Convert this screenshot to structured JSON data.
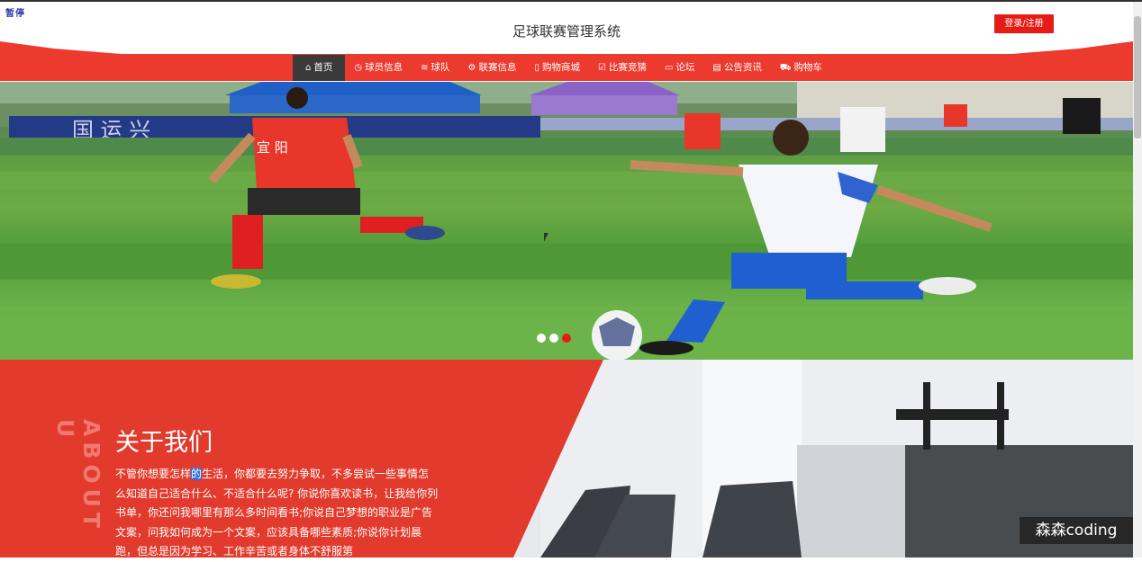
{
  "overlay": {
    "paused_label": "暂停"
  },
  "header": {
    "site_title": "足球联赛管理系统",
    "login_label": "登录/注册"
  },
  "nav": {
    "items": [
      {
        "label": "首页",
        "icon": "home-icon",
        "glyph": "⌂",
        "active": true
      },
      {
        "label": "球员信息",
        "icon": "clock-icon",
        "glyph": "◷",
        "active": false
      },
      {
        "label": "球队",
        "icon": "layers-icon",
        "glyph": "≋",
        "active": false
      },
      {
        "label": "联赛信息",
        "icon": "gear-icon",
        "glyph": "⚙",
        "active": false
      },
      {
        "label": "购物商城",
        "icon": "book-icon",
        "glyph": "▯",
        "active": false
      },
      {
        "label": "比赛竞猜",
        "icon": "check-icon",
        "glyph": "☑",
        "active": false
      },
      {
        "label": "论坛",
        "icon": "chat-icon",
        "glyph": "▭",
        "active": false
      },
      {
        "label": "公告资讯",
        "icon": "news-icon",
        "glyph": "▤",
        "active": false
      },
      {
        "label": "购物车",
        "icon": "cart-icon",
        "glyph": "⛟",
        "active": false
      }
    ]
  },
  "hero": {
    "banner_text": "国 运 兴",
    "jersey_text": "宜 阳",
    "active_slide": 3,
    "slide_count": 3
  },
  "about": {
    "title": "关于我们",
    "vertical_label": "ABOUT U",
    "text_before": "不管你想要怎样",
    "text_selected": "的",
    "text_after": "生活，你都要去努力争取，不多尝试一些事情怎么知道自己适合什么、不适合什么呢? 你说你喜欢读书，让我给你列书单，你还问我哪里有那么多时间看书;你说自己梦想的职业是广告文案，问我如何成为一个文案，应该具备哪些素质;你说你计划晨跑，但总是因为学习、工作辛苦或者身体不舒服第"
  },
  "watermark": {
    "text": "森森coding"
  },
  "colors": {
    "accent": "#e51c16",
    "nav_red": "#ec3a2f",
    "nav_active": "#3a3a3a"
  }
}
